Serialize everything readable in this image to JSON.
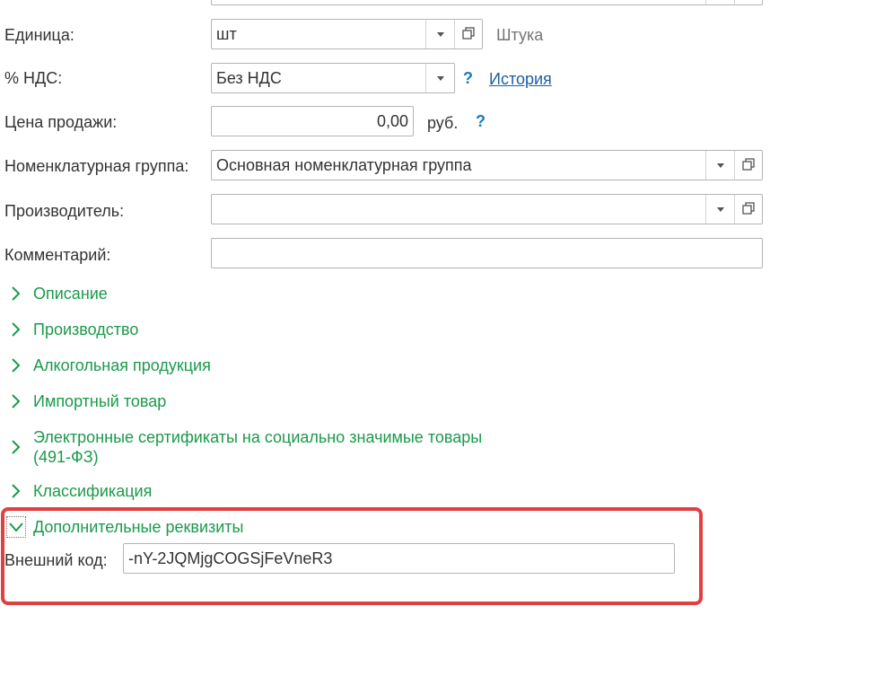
{
  "form": {
    "unit": {
      "label": "Единица:",
      "value": "шт",
      "hint": "Штука"
    },
    "vat": {
      "label": "% НДС:",
      "value": "Без НДС",
      "help": "?",
      "history_link": "История"
    },
    "price": {
      "label": "Цена продажи:",
      "value": "0,00",
      "currency": "руб.",
      "help": "?"
    },
    "nomenclature_group": {
      "label": "Номенклатурная группа:",
      "value": "Основная номенклатурная группа"
    },
    "manufacturer": {
      "label": "Производитель:",
      "value": ""
    },
    "comment": {
      "label": "Комментарий:",
      "value": ""
    }
  },
  "sections": [
    {
      "title": "Описание",
      "expanded": false
    },
    {
      "title": "Производство",
      "expanded": false
    },
    {
      "title": "Алкогольная продукция",
      "expanded": false
    },
    {
      "title": "Импортный товар",
      "expanded": false
    },
    {
      "title_line1": "Электронные сертификаты на социально значимые товары",
      "title_line2": "(491-ФЗ)",
      "expanded": false
    },
    {
      "title": "Классификация",
      "expanded": false
    },
    {
      "title": "Дополнительные реквизиты",
      "expanded": true
    }
  ],
  "extra": {
    "external_code_label": "Внешний код:",
    "external_code_value": "-nY-2JQMjgCOGSjFeVneR3"
  },
  "colors": {
    "section_green": "#1a9a4a",
    "highlight_red": "#e04040",
    "link_blue": "#1a5fa8"
  }
}
